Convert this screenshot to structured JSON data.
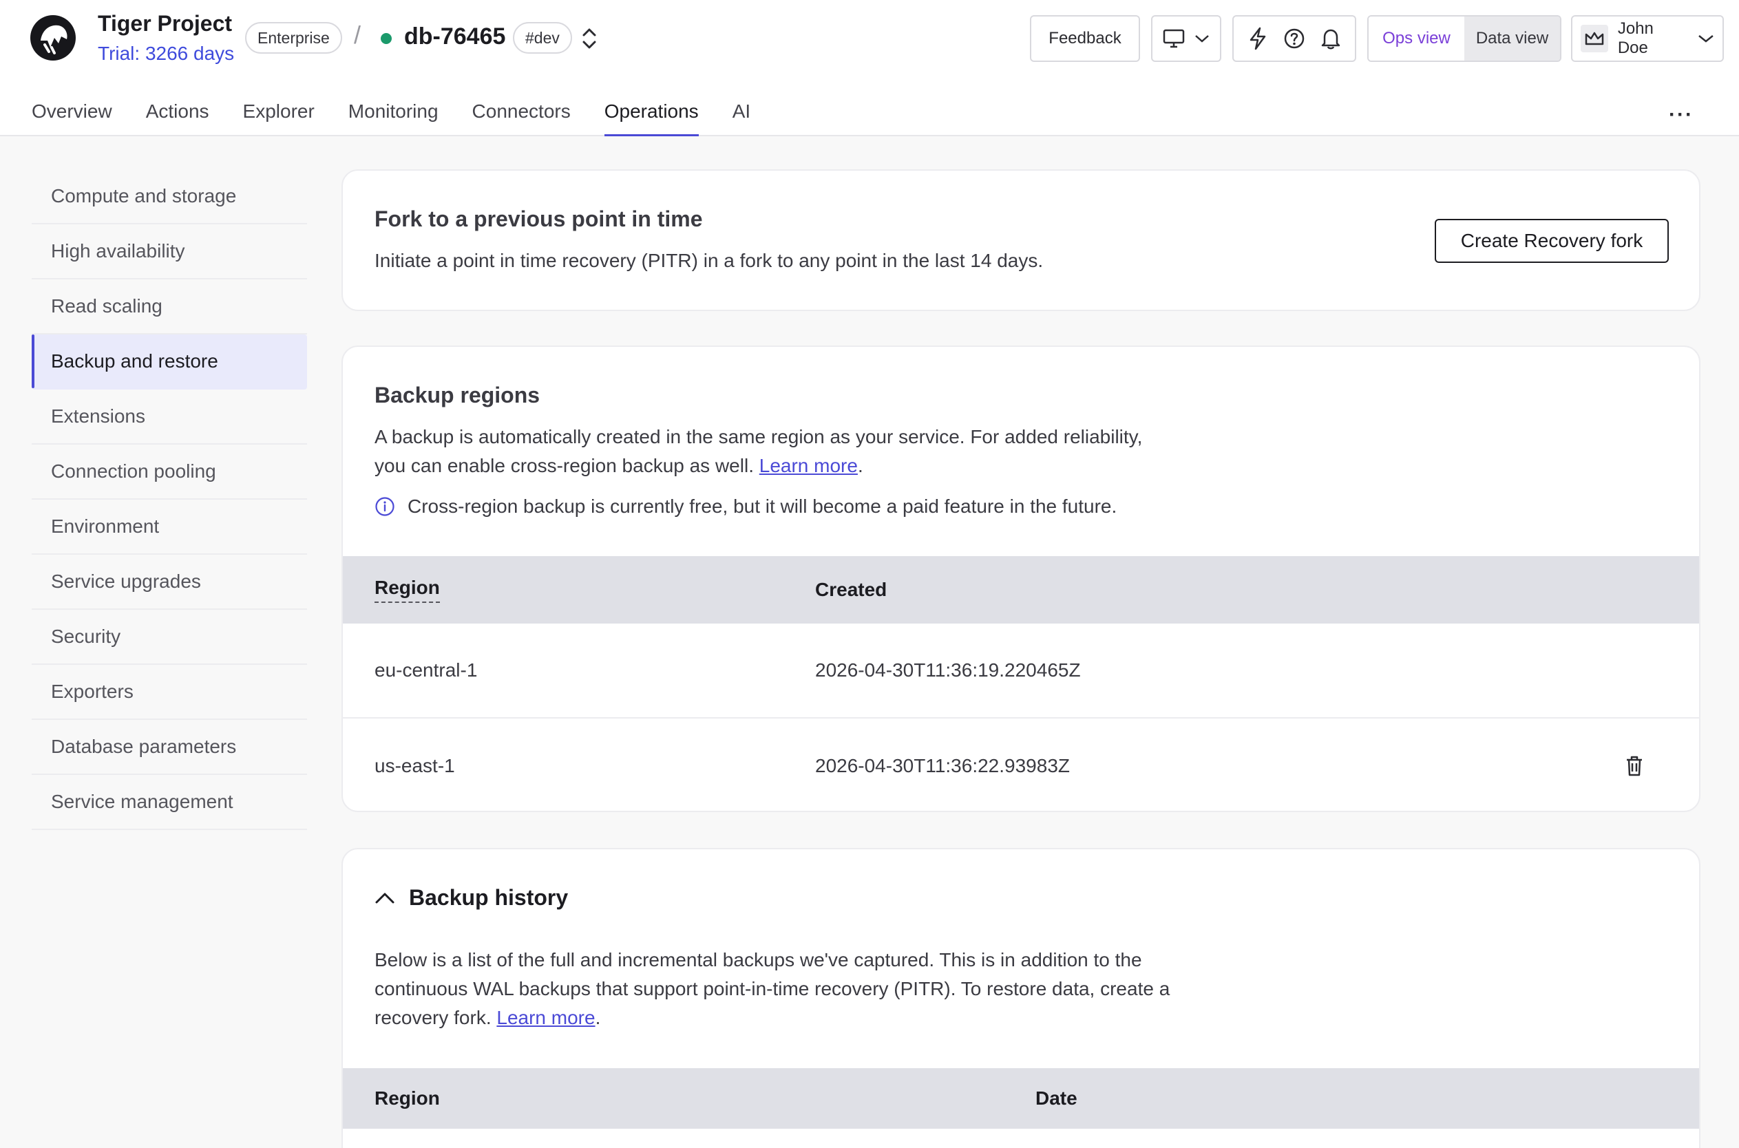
{
  "header": {
    "project_name": "Tiger Project",
    "trial": "Trial: 3266 days",
    "plan_badge": "Enterprise",
    "separator": "/",
    "db_name": "db-76465",
    "env_badge": "#dev",
    "feedback_label": "Feedback",
    "view_toggle": {
      "ops": "Ops view",
      "data": "Data view"
    },
    "user_name": "John Doe",
    "status_color": "#1b9a6b",
    "accent_color": "#4b4ad6"
  },
  "tabs": [
    {
      "label": "Overview"
    },
    {
      "label": "Actions"
    },
    {
      "label": "Explorer"
    },
    {
      "label": "Monitoring"
    },
    {
      "label": "Connectors"
    },
    {
      "label": "Operations"
    },
    {
      "label": "AI"
    }
  ],
  "more_label": "···",
  "sidebar": {
    "items": [
      {
        "label": "Compute and storage"
      },
      {
        "label": "High availability"
      },
      {
        "label": "Read scaling"
      },
      {
        "label": "Backup and restore"
      },
      {
        "label": "Extensions"
      },
      {
        "label": "Connection pooling"
      },
      {
        "label": "Environment"
      },
      {
        "label": "Service upgrades"
      },
      {
        "label": "Security"
      },
      {
        "label": "Exporters"
      },
      {
        "label": "Database parameters"
      },
      {
        "label": "Service management"
      }
    ]
  },
  "fork_card": {
    "title": "Fork to a previous point in time",
    "description": "Initiate a point in time recovery (PITR) in a fork to any point in the last 14 days.",
    "button": "Create Recovery fork"
  },
  "regions_card": {
    "title": "Backup regions",
    "desc_line1": "A backup is automatically created in the same region as your service. For added reliability,",
    "desc_line2": "you can enable cross-region backup as well.",
    "learn_more": "Learn more",
    "period": ".",
    "info": "Cross-region backup is currently free, but it will become a paid feature in the future.",
    "columns": {
      "region": "Region",
      "created": "Created"
    },
    "rows": [
      {
        "region": "eu-central-1",
        "created": "2026-04-30T11:36:19.220465Z"
      },
      {
        "region": "us-east-1",
        "created": "2026-04-30T11:36:22.93983Z"
      }
    ]
  },
  "history_card": {
    "title": "Backup history",
    "line1": "Below is a list of the full and incremental backups we've captured. This is in addition to the",
    "line2": "continuous WAL backups that support point-in-time recovery (PITR). To restore data, create a",
    "line3": "recovery fork.",
    "learn_more": "Learn more",
    "period": ".",
    "columns": {
      "region": "Region",
      "date": "Date"
    }
  }
}
